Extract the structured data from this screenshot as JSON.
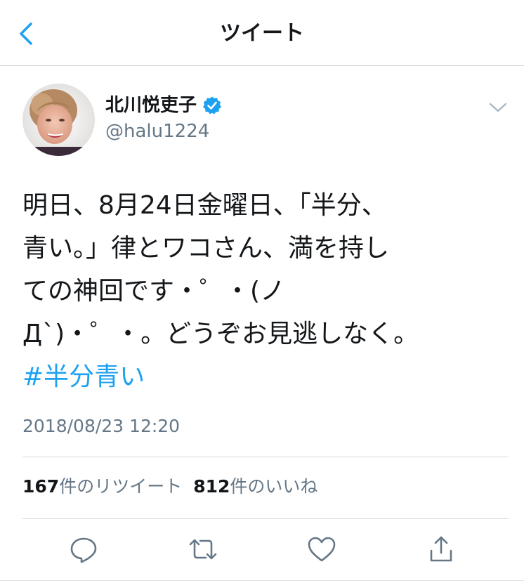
{
  "nav": {
    "title": "ツイート",
    "back_icon": "chevron-left-icon"
  },
  "tweet": {
    "author": {
      "display_name": "北川悦吏子",
      "handle": "@halu1224",
      "verified": true
    },
    "text_lines": [
      "明日、8月24日金曜日、「半分、",
      "青い。」律とワコさん、満を持し",
      "ての神回です・゜・(ノ",
      "Д`)・゜・。どうぞお見逃しなく。"
    ],
    "hashtag": "#半分青い",
    "timestamp": "2018/08/23 12:20",
    "stats": {
      "retweet_count": "167",
      "retweet_label": "件のリツイート",
      "like_count": "812",
      "like_label": "件のいいね"
    }
  },
  "actions": [
    {
      "icon": "reply-icon"
    },
    {
      "icon": "retweet-icon"
    },
    {
      "icon": "like-icon"
    },
    {
      "icon": "share-icon"
    }
  ],
  "colors": {
    "accent": "#1da1f2",
    "secondary_text": "#657786",
    "primary_text": "#14171a",
    "verified_badge": "#1da1f2"
  }
}
